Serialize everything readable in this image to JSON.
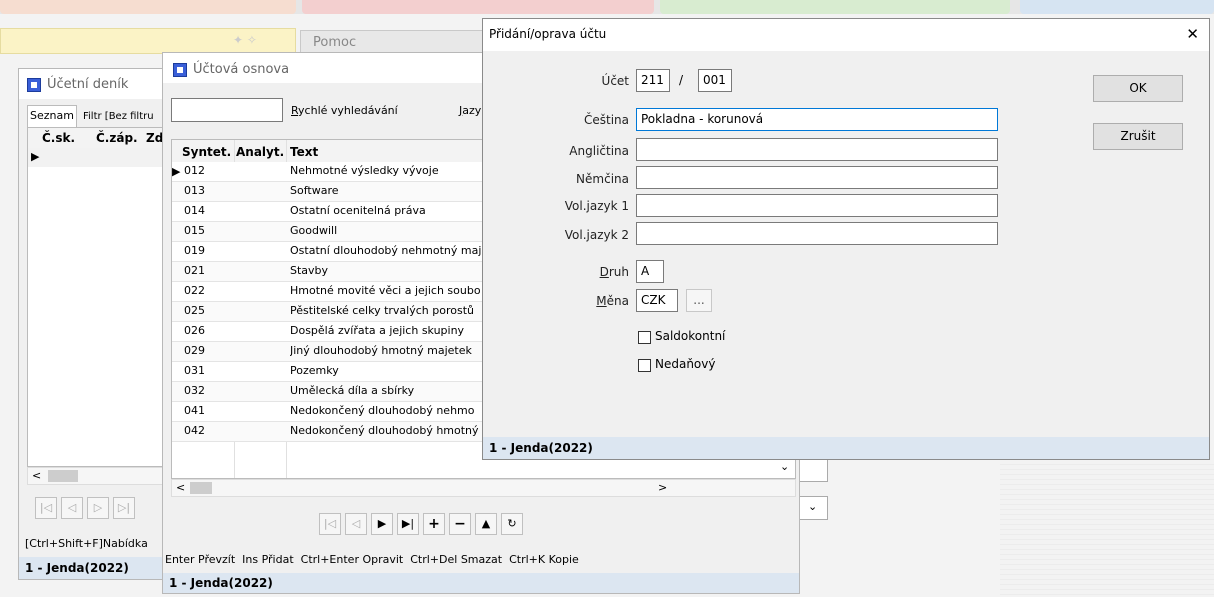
{
  "background_tab": {
    "label": "Pomoc"
  },
  "ucetni_denik": {
    "title": "Účetní deník",
    "tab_seznam": "Seznam",
    "tab_filtr": "Filtr [Bez filtru",
    "columns": [
      "Č.sk.",
      "Č.záp.",
      "Zd"
    ],
    "hint": "[Ctrl+Shift+F]Nabídka",
    "status": "1 - Jenda(2022)"
  },
  "uctova_osnova": {
    "title": "Účtová osnova",
    "search_placeholder": "",
    "quick_search_prefix": "R",
    "quick_search_rest": "ychlé vyhledávání",
    "lang_prefix": "J",
    "lang_rest": "azy",
    "columns": [
      "Syntet.",
      "Analyt.",
      "Text"
    ],
    "rows": [
      {
        "syntet": "012",
        "analyt": "",
        "text": "Nehmotné výsledky vývoje"
      },
      {
        "syntet": "013",
        "analyt": "",
        "text": "Software"
      },
      {
        "syntet": "014",
        "analyt": "",
        "text": "Ostatní ocenitelná práva"
      },
      {
        "syntet": "015",
        "analyt": "",
        "text": "Goodwill"
      },
      {
        "syntet": "019",
        "analyt": "",
        "text": "Ostatní dlouhodobý nehmotný maj"
      },
      {
        "syntet": "021",
        "analyt": "",
        "text": "Stavby"
      },
      {
        "syntet": "022",
        "analyt": "",
        "text": "Hmotné movité věci a jejich soubo"
      },
      {
        "syntet": "025",
        "analyt": "",
        "text": "Pěstitelské celky trvalých porostů"
      },
      {
        "syntet": "026",
        "analyt": "",
        "text": "Dospělá zvířata a jejich skupiny"
      },
      {
        "syntet": "029",
        "analyt": "",
        "text": "Jiný dlouhodobý hmotný majetek"
      },
      {
        "syntet": "031",
        "analyt": "",
        "text": "Pozemky"
      },
      {
        "syntet": "032",
        "analyt": "",
        "text": "Umělecká díla a sbírky"
      },
      {
        "syntet": "041",
        "analyt": "",
        "text": "Nedokončený dlouhodobý nehmo"
      },
      {
        "syntet": "042",
        "analyt": "",
        "text": "Nedokončený dlouhodobý hmotný"
      }
    ],
    "shortcuts": "Enter Převzít  Ins Přidat  Ctrl+Enter Opravit  Ctrl+Del Smazat  Ctrl+K Kopie",
    "status": "1 - Jenda(2022)"
  },
  "dialog": {
    "title": "Přidání/oprava účtu",
    "close_glyph": "✕",
    "ucet_label": "Účet",
    "ucet_syntet": "211",
    "ucet_sep": "/",
    "ucet_analyt": "001",
    "cestina_label": "Čeština",
    "cestina_value": "Pokladna - korunová",
    "anglictina_label": "Angličtina",
    "anglictina_value": "",
    "nemcina_label": "Němčina",
    "nemcina_value": "",
    "voljazyk1_label": "Vol.jazyk 1",
    "voljazyk1_value": "",
    "voljazyk2_label": "Vol.jazyk 2",
    "voljazyk2_value": "",
    "druh_prefix": "D",
    "druh_rest": "ruh",
    "druh_value": "A",
    "mena_prefix": "M",
    "mena_rest": "ěna",
    "mena_value": "CZK",
    "mena_browse": "...",
    "saldokontni_label": "Saldokontní",
    "nedanovy_label": "Nedaňový",
    "ok_label": "OK",
    "zrusit_label": "Zrušit",
    "status": "1 - Jenda(2022)"
  }
}
